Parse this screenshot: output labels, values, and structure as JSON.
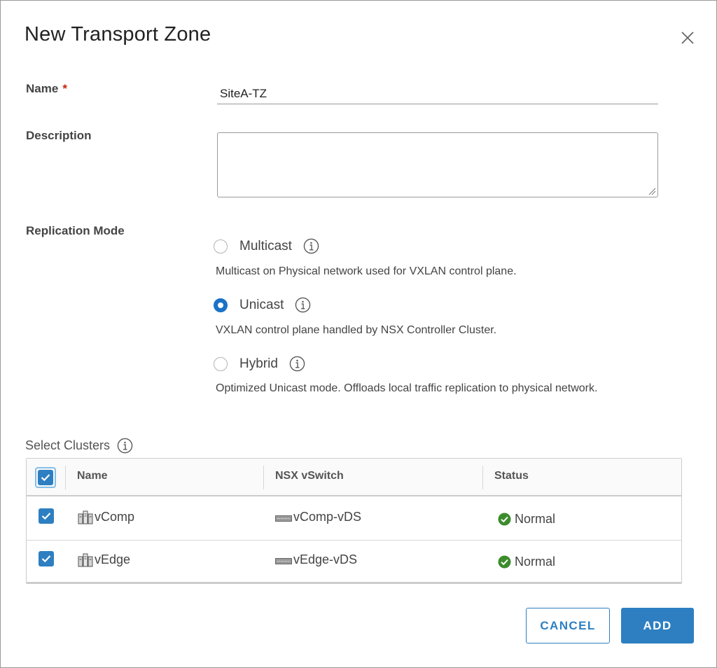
{
  "dialog": {
    "title": "New Transport Zone",
    "close_icon": "close-icon"
  },
  "form": {
    "name_label": "Name",
    "required_mark": "*",
    "name_value": "SiteA-TZ",
    "description_label": "Description",
    "description_value": "",
    "replication_label": "Replication Mode",
    "replication_options": [
      {
        "label": "Multicast",
        "description": "Multicast on Physical network used for VXLAN control plane.",
        "selected": false
      },
      {
        "label": "Unicast",
        "description": "VXLAN control plane handled by NSX Controller Cluster.",
        "selected": true
      },
      {
        "label": "Hybrid",
        "description": "Optimized Unicast mode. Offloads local traffic replication to physical network.",
        "selected": false
      }
    ]
  },
  "clusters": {
    "label": "Select Clusters",
    "columns": [
      "Name",
      "NSX vSwitch",
      "Status"
    ],
    "rows": [
      {
        "name": "vComp",
        "vswitch": "vComp-vDS",
        "status": "Normal",
        "checked": true
      },
      {
        "name": "vEdge",
        "vswitch": "vEdge-vDS",
        "status": "Normal",
        "checked": true
      }
    ]
  },
  "buttons": {
    "cancel": "CANCEL",
    "add": "ADD"
  },
  "colors": {
    "primary": "#2d7fc1",
    "radio_selected": "#1a73c7",
    "required": "#c92100",
    "status_ok": "#3c8c2c"
  }
}
